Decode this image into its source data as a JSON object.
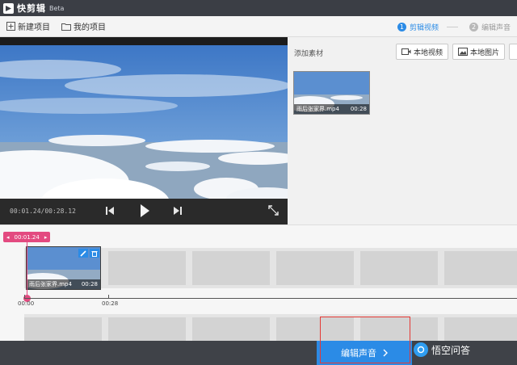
{
  "titlebar": {
    "app_name": "快剪辑",
    "beta": "Beta"
  },
  "toolbar": {
    "new_project": "新建项目",
    "my_projects": "我的项目"
  },
  "steps": [
    {
      "num": "1",
      "label": "剪辑视频",
      "state": "active"
    },
    {
      "num": "2",
      "label": "编辑声音",
      "state": "inactive"
    }
  ],
  "player": {
    "time": "00:01.24/00:28.12"
  },
  "materials": {
    "title": "添加素材",
    "local_video": "本地视频",
    "local_image": "本地图片",
    "items": [
      {
        "name": "雨后张家界.mp4",
        "duration": "00:28"
      }
    ]
  },
  "timeline": {
    "playhead": "00:01.24",
    "clip": {
      "name": "雨后张家界.mp4",
      "duration": "00:28"
    },
    "ticks": [
      "00:00",
      "00:28"
    ]
  },
  "bottom": {
    "next_button": "编辑声音",
    "watermark": "悟空问答"
  },
  "colors": {
    "accent": "#2b8be6",
    "playhead": "#e34a80",
    "highlight": "#e53935"
  },
  "icons": [
    "app-logo-icon",
    "new-project-icon",
    "folder-icon",
    "prev-icon",
    "play-icon",
    "next-icon",
    "fullscreen-icon",
    "video-add-icon",
    "image-add-icon",
    "edit-icon",
    "delete-icon",
    "chevron-right-icon"
  ]
}
